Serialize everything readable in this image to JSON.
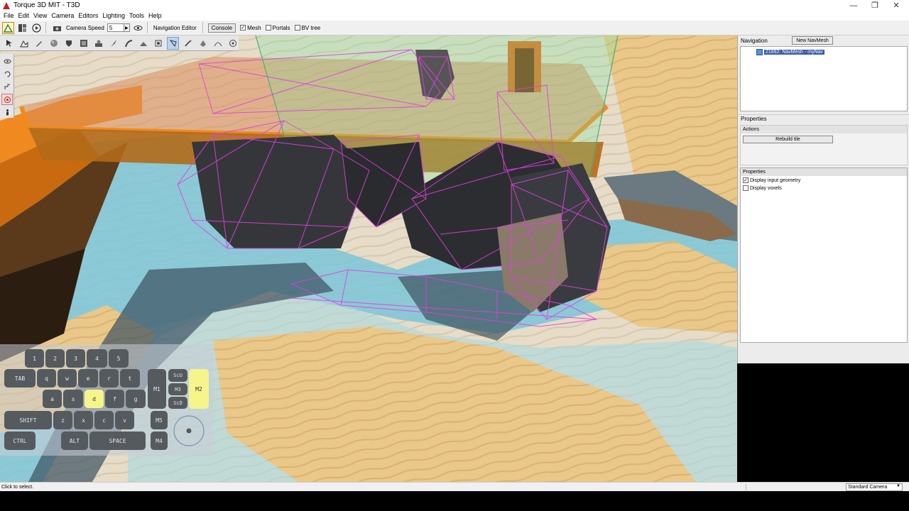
{
  "window": {
    "title": "Torque 3D MIT - T3D",
    "minimize_glyph": "—",
    "restore_glyph": "❐",
    "close_glyph": "✕"
  },
  "menu": [
    {
      "label": "File"
    },
    {
      "label": "Edit"
    },
    {
      "label": "View"
    },
    {
      "label": "Camera"
    },
    {
      "label": "Editors"
    },
    {
      "label": "Lighting"
    },
    {
      "label": "Tools"
    },
    {
      "label": "Help"
    }
  ],
  "toolbar": {
    "camera_speed_label": "Camera Speed",
    "camera_speed_value": "5",
    "spin_glyph": "▶",
    "editor_label": "Navigation Editor",
    "console_button": "Console",
    "checks": [
      {
        "label": "Mesh",
        "checked": true
      },
      {
        "label": "Portals",
        "checked": false
      },
      {
        "label": "BV tree",
        "checked": false
      }
    ]
  },
  "navigation_panel": {
    "header": "Navigation",
    "new_navmesh_button": "New NavMesh",
    "tree_item": "21892: NavMesh - myNav",
    "properties_header": "Properties",
    "actions_header": "Actions",
    "rebuild_tile_button": "Rebuild tile",
    "properties_section_header": "Properties",
    "property_checks": [
      {
        "label": "Display input geometry",
        "checked": true
      },
      {
        "label": "Display voxels",
        "checked": false
      }
    ]
  },
  "keyboard_overlay": {
    "keys": [
      {
        "label": "1",
        "highlighted": false
      },
      {
        "label": "2",
        "highlighted": false
      },
      {
        "label": "3",
        "highlighted": false
      },
      {
        "label": "4",
        "highlighted": false
      },
      {
        "label": "5",
        "highlighted": false
      },
      {
        "label": "TAB",
        "highlighted": false
      },
      {
        "label": "q",
        "highlighted": false
      },
      {
        "label": "w",
        "highlighted": false
      },
      {
        "label": "e",
        "highlighted": false
      },
      {
        "label": "r",
        "highlighted": false
      },
      {
        "label": "t",
        "highlighted": false
      },
      {
        "label": "a",
        "highlighted": false
      },
      {
        "label": "s",
        "highlighted": false
      },
      {
        "label": "d",
        "highlighted": true
      },
      {
        "label": "f",
        "highlighted": false
      },
      {
        "label": "g",
        "highlighted": false
      },
      {
        "label": "SHIFT",
        "highlighted": false
      },
      {
        "label": "z",
        "highlighted": false
      },
      {
        "label": "x",
        "highlighted": false
      },
      {
        "label": "c",
        "highlighted": false
      },
      {
        "label": "v",
        "highlighted": false
      },
      {
        "label": "CTRL",
        "highlighted": false
      },
      {
        "label": "ALT",
        "highlighted": false
      },
      {
        "label": "SPACE",
        "highlighted": false
      },
      {
        "label": "M1",
        "highlighted": false
      },
      {
        "label": "ScU",
        "highlighted": false
      },
      {
        "label": "M3",
        "highlighted": false
      },
      {
        "label": "ScD",
        "highlighted": false
      },
      {
        "label": "M2",
        "highlighted": true
      },
      {
        "label": "M5",
        "highlighted": false
      },
      {
        "label": "M4",
        "highlighted": false
      }
    ]
  },
  "statusbar": {
    "text": "Click to select.",
    "camera_mode": "Standard Camera",
    "dropdown_glyph": "▼"
  },
  "colors": {
    "navmesh_wire": "#e040e0",
    "platform_orange": "#f08a20",
    "sand": "#e8c98a",
    "water": "#4aa8c4"
  }
}
